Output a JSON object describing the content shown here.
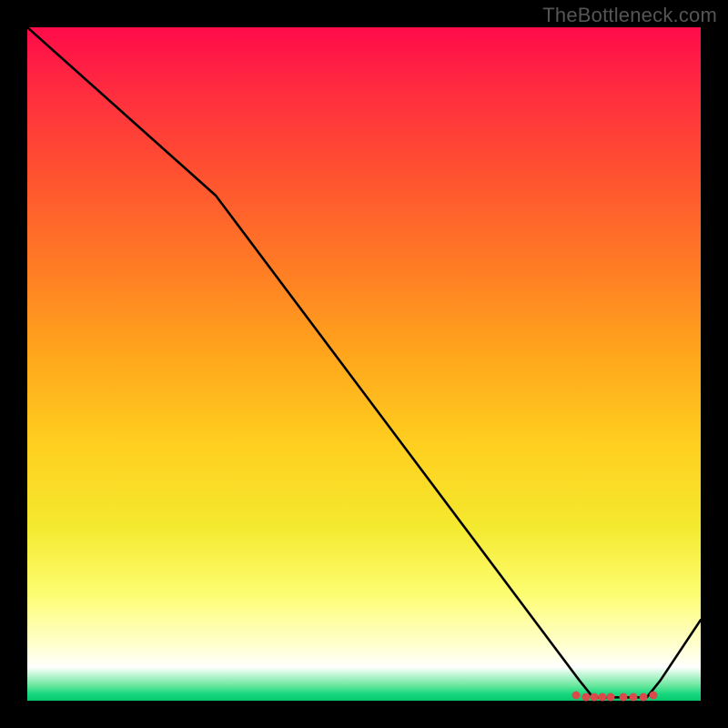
{
  "attribution": "TheBottleneck.com",
  "chart_data": {
    "type": "line",
    "title": "",
    "xlabel": "",
    "ylabel": "",
    "xlim": [
      0,
      100
    ],
    "ylim": [
      0,
      100
    ],
    "curve": [
      {
        "x": 0,
        "y": 100
      },
      {
        "x": 28,
        "y": 75
      },
      {
        "x": 82,
        "y": 3
      },
      {
        "x": 84,
        "y": 0.5
      },
      {
        "x": 92,
        "y": 0.5
      },
      {
        "x": 94,
        "y": 3
      },
      {
        "x": 100,
        "y": 12
      }
    ],
    "markers": [
      {
        "x": 81.5,
        "y": 0.8
      },
      {
        "x": 83.0,
        "y": 0.6
      },
      {
        "x": 84.2,
        "y": 0.5
      },
      {
        "x": 85.4,
        "y": 0.5
      },
      {
        "x": 86.6,
        "y": 0.5
      },
      {
        "x": 88.5,
        "y": 0.5
      },
      {
        "x": 90.0,
        "y": 0.5
      },
      {
        "x": 91.5,
        "y": 0.6
      },
      {
        "x": 93.0,
        "y": 0.8
      }
    ],
    "gradient_stops": [
      {
        "offset": 0,
        "color": "#ff0b49"
      },
      {
        "offset": 0.62,
        "color": "#ffcf1f"
      },
      {
        "offset": 0.92,
        "color": "#ffffd2"
      },
      {
        "offset": 0.99,
        "color": "#17d87e"
      }
    ]
  }
}
